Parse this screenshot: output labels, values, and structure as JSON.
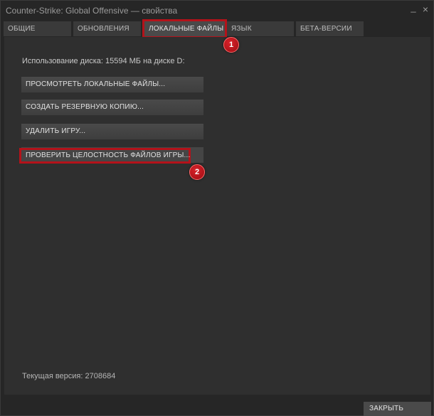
{
  "window": {
    "title": "Counter-Strike: Global Offensive — свойства",
    "min_glyph": "_",
    "close_glyph": "×"
  },
  "tabs": [
    {
      "label": "ОБЩИЕ"
    },
    {
      "label": "ОБНОВЛЕНИЯ"
    },
    {
      "label": "ЛОКАЛЬНЫЕ ФАЙЛЫ",
      "active": true
    },
    {
      "label": "ЯЗЫК"
    },
    {
      "label": "БЕТА-ВЕРСИИ"
    }
  ],
  "local_files": {
    "disk_usage": "Использование диска: 15594 МБ на диске D:",
    "buttons": [
      {
        "label": "ПРОСМОТРЕТЬ ЛОКАЛЬНЫЕ ФАЙЛЫ..."
      },
      {
        "label": "СОЗДАТЬ РЕЗЕРВНУЮ КОПИЮ..."
      },
      {
        "label": "УДАЛИТЬ ИГРУ..."
      },
      {
        "label": "ПРОВЕРИТЬ ЦЕЛОСТНОСТЬ ФАЙЛОВ ИГРЫ..."
      }
    ],
    "version": "Текущая версия: 2708684"
  },
  "annotations": {
    "badge_1": "1",
    "badge_2": "2",
    "highlight_color": "#b4121a"
  },
  "footer": {
    "close_label": "ЗАКРЫТЬ"
  }
}
